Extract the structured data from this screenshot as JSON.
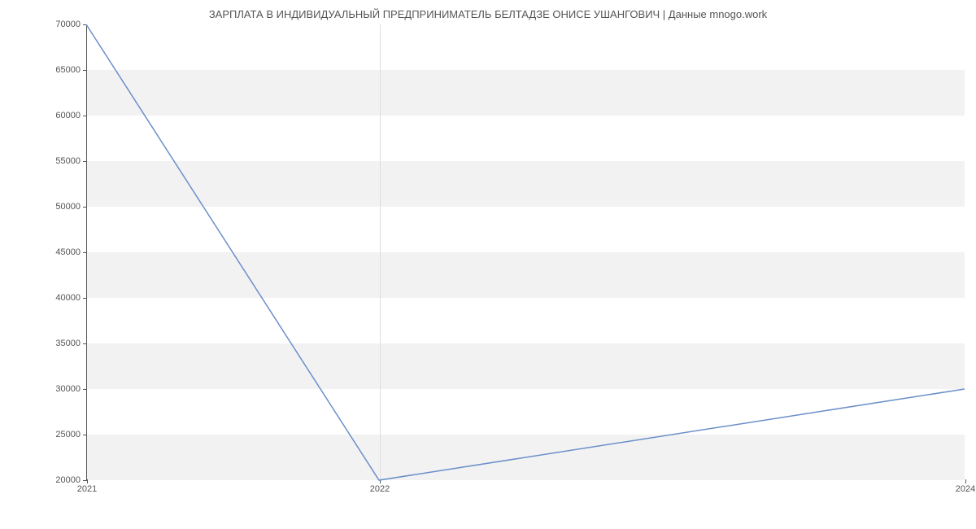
{
  "chart_data": {
    "type": "line",
    "title": "ЗАРПЛАТА В ИНДИВИДУАЛЬНЫЙ ПРЕДПРИНИМАТЕЛЬ БЕЛТАДЗЕ ОНИСЕ УШАНГОВИЧ | Данные mnogo.work",
    "xlabel": "",
    "ylabel": "",
    "x": [
      2021,
      2022,
      2024
    ],
    "values": [
      70000,
      20000,
      30000
    ],
    "xlim": [
      2021,
      2024
    ],
    "ylim": [
      20000,
      70000
    ],
    "y_ticks": [
      20000,
      25000,
      30000,
      35000,
      40000,
      45000,
      50000,
      55000,
      60000,
      65000,
      70000
    ],
    "x_ticks": [
      2021,
      2022,
      2024
    ],
    "line_color": "#6b8fc9"
  }
}
